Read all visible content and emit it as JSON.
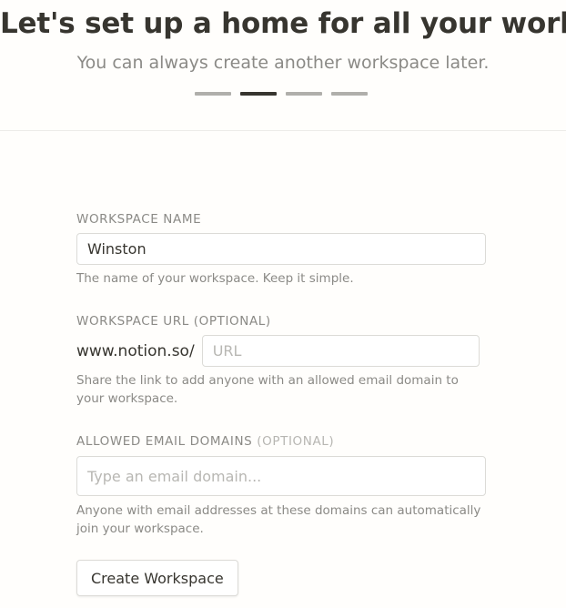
{
  "header": {
    "title": "Let's set up a home for all your work",
    "subtitle": "You can always create another workspace later.",
    "steps_total": 4,
    "steps_active_index": 1
  },
  "workspace_name": {
    "label": "WORKSPACE NAME",
    "value": "Winston",
    "help": "The name of your workspace. Keep it simple."
  },
  "workspace_url": {
    "label": "WORKSPACE URL (OPTIONAL)",
    "prefix": "www.notion.so/",
    "placeholder": "URL",
    "help": "Share the link to add anyone with an allowed email domain to your workspace."
  },
  "allowed_domains": {
    "label": "ALLOWED EMAIL DOMAINS",
    "label_optional": "(OPTIONAL)",
    "placeholder": "Type an email domain...",
    "help": "Anyone with email addresses at these domains can automatically join your workspace."
  },
  "submit": {
    "label": "Create Workspace"
  },
  "colors": {
    "text": "#37352f",
    "muted": "#8b8a86",
    "step_inactive": "#b0afab",
    "step_active": "#37352f",
    "background": "#fffefc"
  }
}
